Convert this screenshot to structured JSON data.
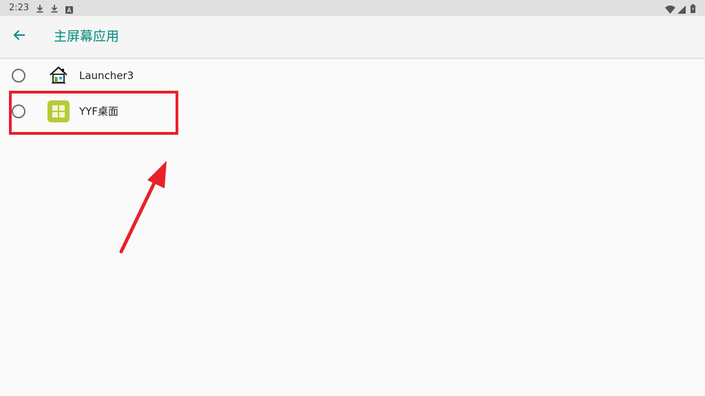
{
  "status_bar": {
    "time": "2:23",
    "left_icons": [
      "download-icon",
      "download-icon",
      "notification-a-icon"
    ],
    "right_icons": [
      "wifi-icon",
      "signal-icon",
      "battery-icon"
    ]
  },
  "app_bar": {
    "title": "主屏幕应用",
    "back_icon": "arrow-left-icon",
    "accent_color": "#00897b"
  },
  "launchers": [
    {
      "label": "Launcher3",
      "icon": "home-icon",
      "selected": false
    },
    {
      "label": "YYF桌面",
      "icon": "yyf-desktop-icon",
      "selected": false
    }
  ],
  "annotation": {
    "highlight_color": "#e8202a",
    "highlighted_item": "YYF桌面"
  }
}
